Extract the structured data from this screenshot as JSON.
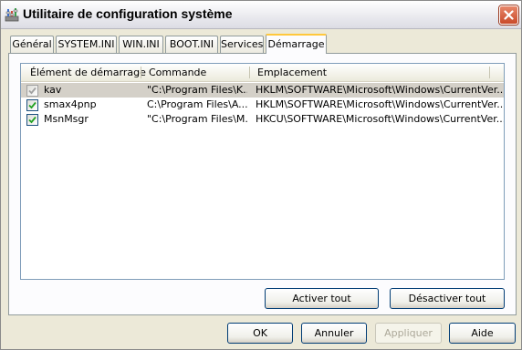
{
  "window": {
    "title": "Utilitaire de configuration système"
  },
  "tabs": [
    {
      "label": "Général"
    },
    {
      "label": "SYSTEM.INI"
    },
    {
      "label": "WIN.INI"
    },
    {
      "label": "BOOT.INI"
    },
    {
      "label": "Services"
    },
    {
      "label": "Démarrage",
      "active": true
    }
  ],
  "startup": {
    "columns": [
      "Élément de démarrage",
      "Commande",
      "Emplacement"
    ],
    "rows": [
      {
        "checked": true,
        "disabled": true,
        "selected": true,
        "name": "kav",
        "command": "\"C:\\Program Files\\K...",
        "location": "HKLM\\SOFTWARE\\Microsoft\\Windows\\CurrentVer..."
      },
      {
        "checked": true,
        "name": "smax4pnp",
        "command": "C:\\Program Files\\A...",
        "location": "HKLM\\SOFTWARE\\Microsoft\\Windows\\CurrentVer..."
      },
      {
        "checked": true,
        "name": "MsnMsgr",
        "command": "\"C:\\Program Files\\M...",
        "location": "HKCU\\SOFTWARE\\Microsoft\\Windows\\CurrentVer..."
      }
    ],
    "enable_all_label": "Activer tout",
    "disable_all_label": "Désactiver tout"
  },
  "buttons": {
    "ok": "OK",
    "cancel": "Annuler",
    "apply": "Appliquer",
    "help": "Aide"
  },
  "colors": {
    "tab_highlight": "#ffc83c",
    "selection": "#d4d0c8",
    "close_button": "#c94a2a"
  }
}
